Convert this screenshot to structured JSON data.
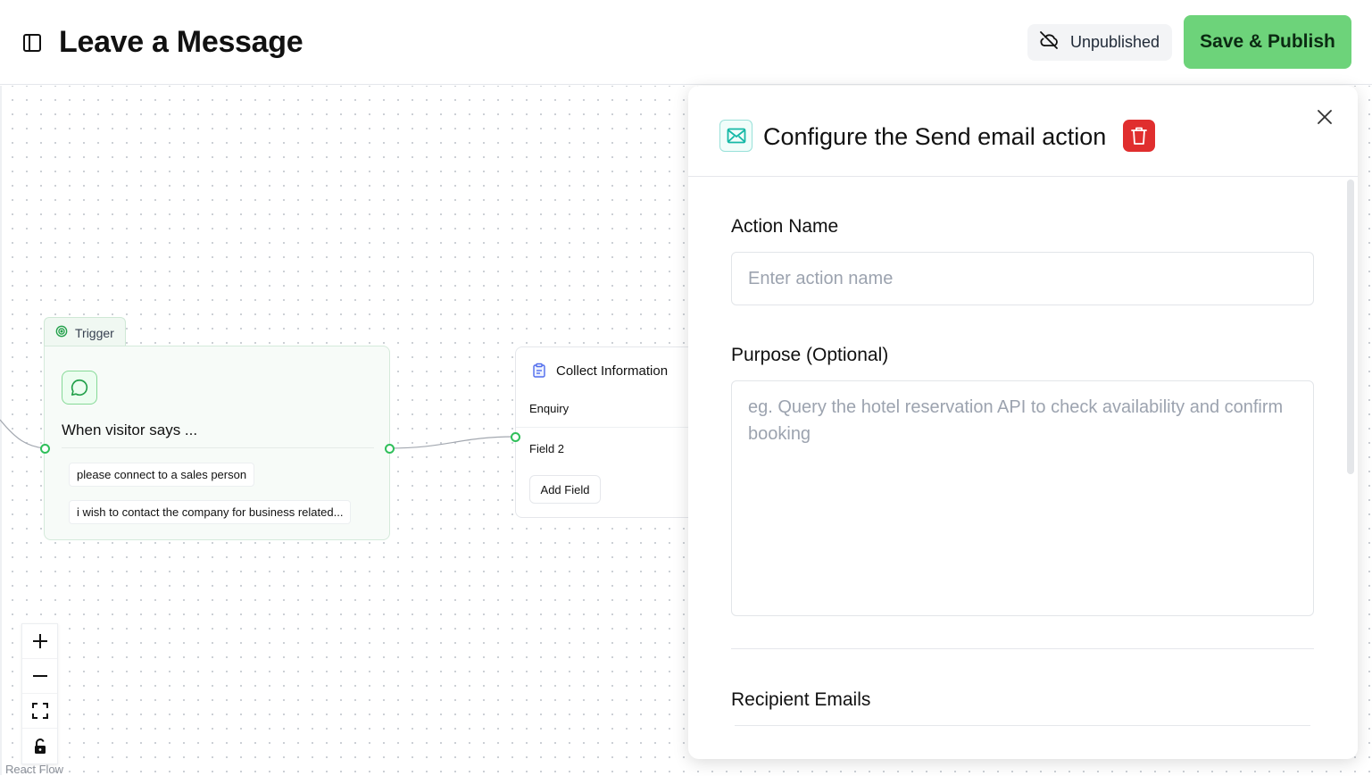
{
  "header": {
    "title": "Leave a Message",
    "status_label": "Unpublished",
    "publish_label": "Save & Publish"
  },
  "trigger": {
    "tab_label": "Trigger",
    "heading": "When visitor says ...",
    "phrases": [
      "please connect to a sales person",
      "i wish to contact the company for business related..."
    ]
  },
  "collect_node": {
    "title": "Collect Information",
    "fields": [
      "Enquiry",
      "Field 2"
    ],
    "add_field_label": "Add Field"
  },
  "canvas": {
    "attribution": "React Flow",
    "dot_color": "#c8ccd2"
  },
  "panel": {
    "title": "Configure the Send email action",
    "action_name": {
      "label": "Action Name",
      "placeholder": "Enter action name",
      "value": ""
    },
    "purpose": {
      "label": "Purpose (Optional)",
      "placeholder": "eg. Query the hotel reservation API to check availability and confirm booking",
      "value": ""
    },
    "recipients": {
      "label": "Recipient Emails"
    }
  },
  "colors": {
    "accent_green": "#6dd37a",
    "handle_green": "#2fbf5a",
    "delete_red": "#e02e2e",
    "mail_teal": "#14b8a6"
  },
  "icons": {
    "sidebar_toggle": "sidebar-toggle-icon",
    "status": "cloud-off-icon",
    "trigger": "target-icon",
    "chat": "message-circle-icon",
    "collect": "clipboard-icon",
    "mail": "mail-icon",
    "delete": "trash-icon",
    "close": "close-icon",
    "zoom_in": "plus-icon",
    "zoom_out": "minus-icon",
    "fit_view": "fit-view-icon",
    "lock": "lock-icon"
  }
}
